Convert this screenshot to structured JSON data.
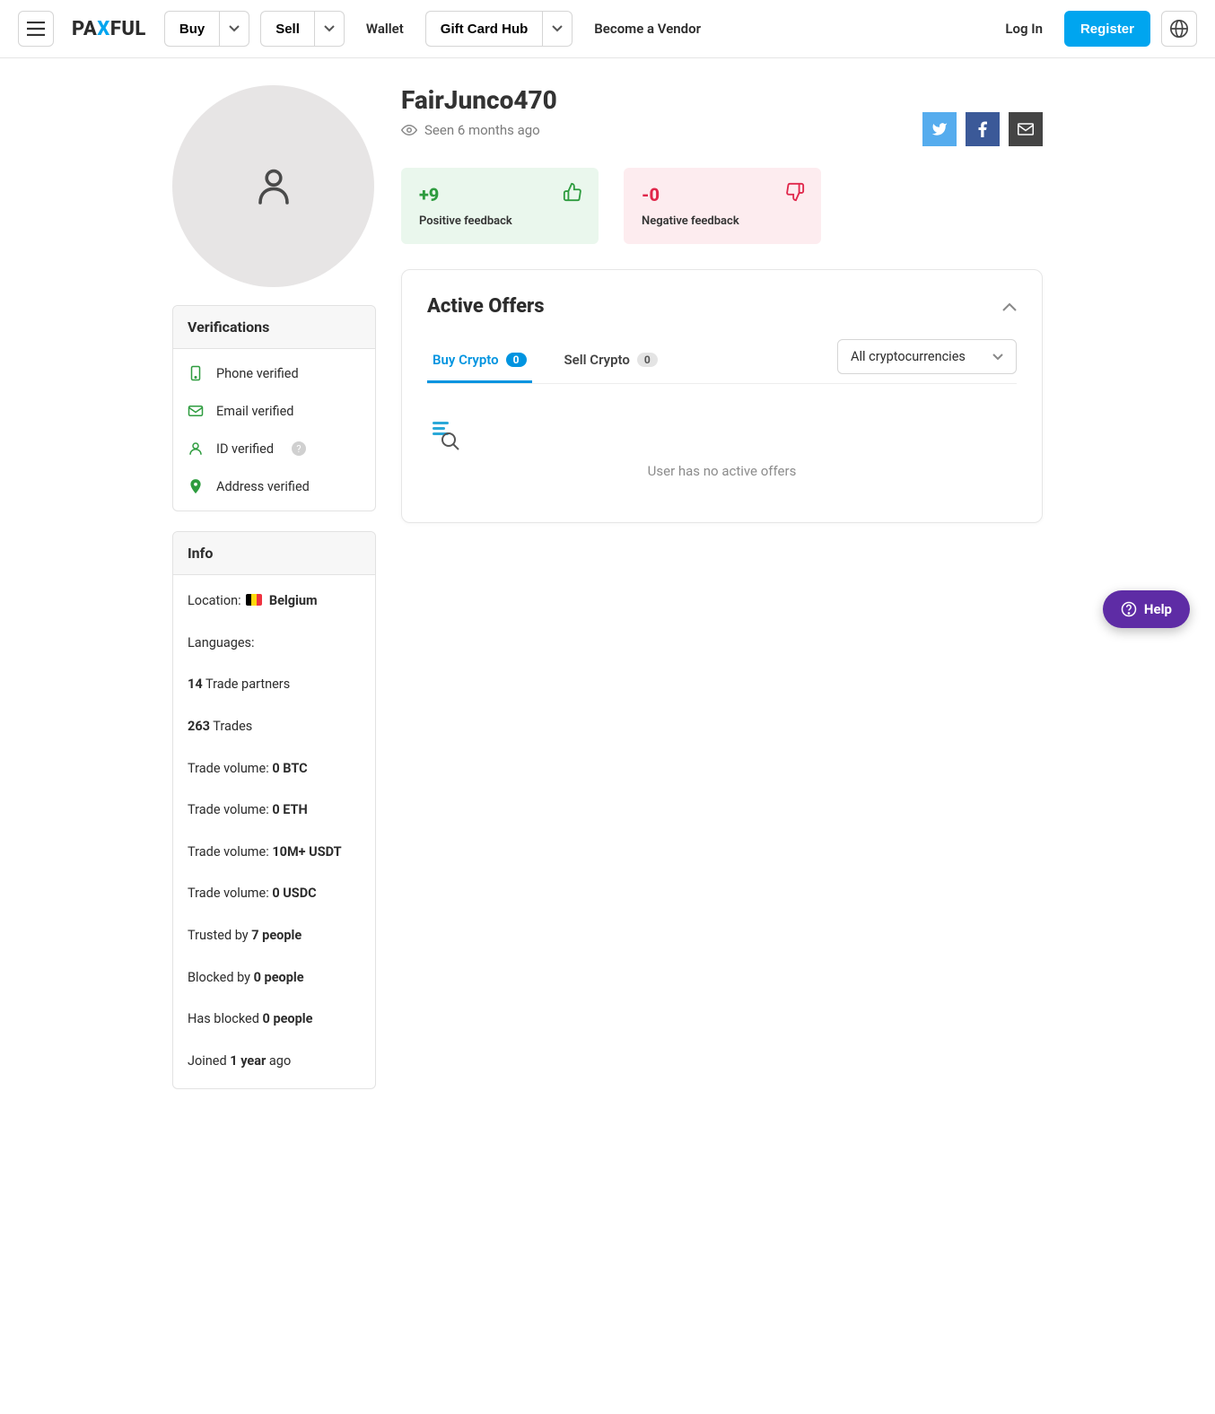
{
  "nav": {
    "buy": "Buy",
    "sell": "Sell",
    "wallet": "Wallet",
    "gift_card_hub": "Gift Card Hub",
    "become_vendor": "Become a Vendor",
    "login": "Log In",
    "register": "Register"
  },
  "logo": {
    "pa": "PA",
    "x": "X",
    "ful": "FUL"
  },
  "profile": {
    "username": "FairJunco470",
    "seen": "Seen 6 months ago"
  },
  "feedback": {
    "pos_value": "+9",
    "pos_label": "Positive feedback",
    "neg_value": "-0",
    "neg_label": "Negative feedback"
  },
  "verifications": {
    "title": "Verifications",
    "phone": "Phone verified",
    "email": "Email verified",
    "id": "ID verified",
    "address": "Address verified"
  },
  "info": {
    "title": "Info",
    "location_label": "Location:",
    "location_value": "Belgium",
    "languages_label": "Languages:",
    "trade_partners_value": "14",
    "trade_partners_label": " Trade partners",
    "trades_value": "263",
    "trades_label": " Trades",
    "tv_label": "Trade volume: ",
    "tv_btc": "0 BTC",
    "tv_eth": "0 ETH",
    "tv_usdt": "10M+ USDT",
    "tv_usdc": "0 USDC",
    "trusted_label": "Trusted by ",
    "trusted_value": "7 people",
    "blocked_by_label": "Blocked by ",
    "blocked_by_value": "0 people",
    "has_blocked_label": "Has blocked ",
    "has_blocked_value": "0 people",
    "joined_label": "Joined ",
    "joined_value": "1 year",
    "joined_suffix": " ago"
  },
  "offers": {
    "title": "Active Offers",
    "buy_tab": "Buy Crypto",
    "buy_count": "0",
    "sell_tab": "Sell Crypto",
    "sell_count": "0",
    "filter": "All cryptocurrencies",
    "empty": "User has no active offers"
  },
  "help": {
    "label": "Help"
  }
}
